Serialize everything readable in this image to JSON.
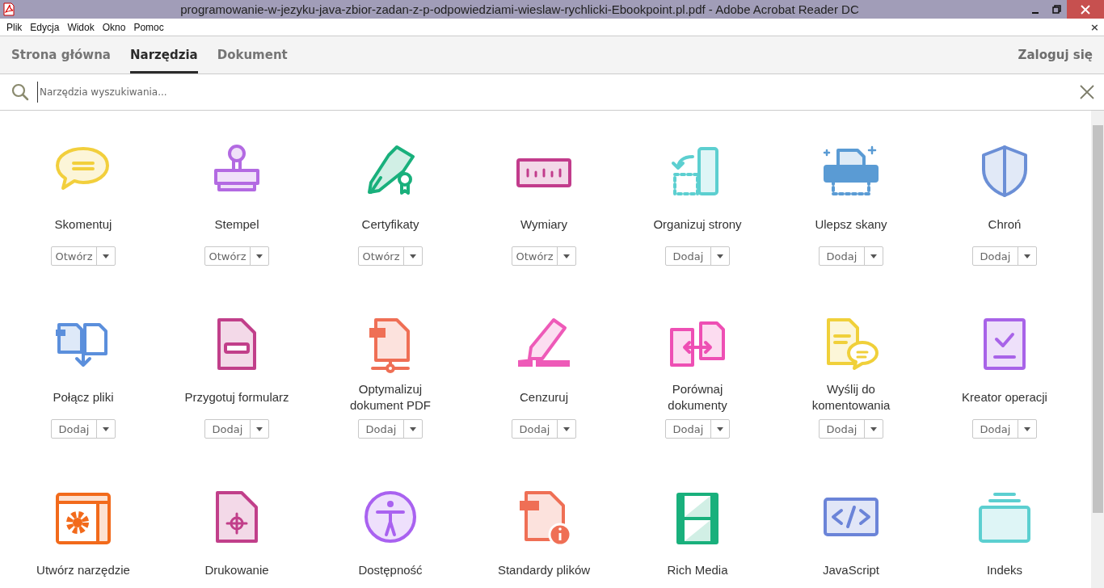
{
  "window": {
    "title": "programowanie-w-jezyku-java-zbior-zadan-z-p-odpowiedziami-wieslaw-rychlicki-Ebookpoint.pl.pdf - Adobe Acrobat Reader DC"
  },
  "menu": [
    "Plik",
    "Edycja",
    "Widok",
    "Okno",
    "Pomoc"
  ],
  "menu_close": "×",
  "tabs": [
    {
      "label": "Strona główna",
      "selected": false
    },
    {
      "label": "Narzędzia",
      "selected": true
    },
    {
      "label": "Dokument",
      "selected": false
    }
  ],
  "sign_in": "Zaloguj się",
  "search": {
    "placeholder": "Narzędzia wyszukiwania..."
  },
  "tools": [
    {
      "kind": "comment",
      "color": "#f2cf3c",
      "name": "Skomentuj",
      "button": "Otwórz"
    },
    {
      "kind": "stamp",
      "color": "#b36ae2",
      "name": "Stempel",
      "button": "Otwórz"
    },
    {
      "kind": "pen",
      "color": "#19b07c",
      "name": "Certyfikaty",
      "button": "Otwórz"
    },
    {
      "kind": "ruler",
      "color": "#c23c8c",
      "name": "Wymiary",
      "button": "Otwórz"
    },
    {
      "kind": "organize",
      "color": "#5ccfd0",
      "name": "Organizuj strony",
      "button": "Dodaj"
    },
    {
      "kind": "scan",
      "color": "#5a9bd4",
      "name": "Ulepsz skany",
      "button": "Dodaj"
    },
    {
      "kind": "shield",
      "color": "#6b8fd6",
      "name": "Chroń",
      "button": "Dodaj"
    },
    {
      "kind": "combine",
      "color": "#5b8fdc",
      "name": "Połącz pliki",
      "button": "Dodaj"
    },
    {
      "kind": "form",
      "color": "#c13f8a",
      "name": "Przygotuj formularz",
      "button": "Dodaj"
    },
    {
      "kind": "optimize",
      "color": "#ef6f55",
      "name": "Optymalizuj dokument PDF",
      "button": "Dodaj"
    },
    {
      "kind": "redact",
      "color": "#ee5ab8",
      "name": "Cenzuruj",
      "button": "Dodaj"
    },
    {
      "kind": "compare",
      "color": "#ee4fb4",
      "name": "Porównaj dokumenty",
      "button": "Dodaj"
    },
    {
      "kind": "send",
      "color": "#f0d03a",
      "name": "Wyślij do komentowania",
      "button": "Dodaj"
    },
    {
      "kind": "action",
      "color": "#a863e8",
      "name": "Kreator operacji",
      "button": "Dodaj"
    },
    {
      "kind": "custom",
      "color": "#f26a1b",
      "name": "Utwórz narzędzie"
    },
    {
      "kind": "print",
      "color": "#c13f8a",
      "name": "Drukowanie"
    },
    {
      "kind": "access",
      "color": "#a962f0",
      "name": "Dostępność"
    },
    {
      "kind": "standards",
      "color": "#ef6f55",
      "name": "Standardy plików"
    },
    {
      "kind": "film",
      "color": "#19b07c",
      "name": "Rich Media"
    },
    {
      "kind": "script",
      "color": "#6b84d8",
      "name": "JavaScript"
    },
    {
      "kind": "index",
      "color": "#5ccfd0",
      "name": "Indeks"
    }
  ]
}
